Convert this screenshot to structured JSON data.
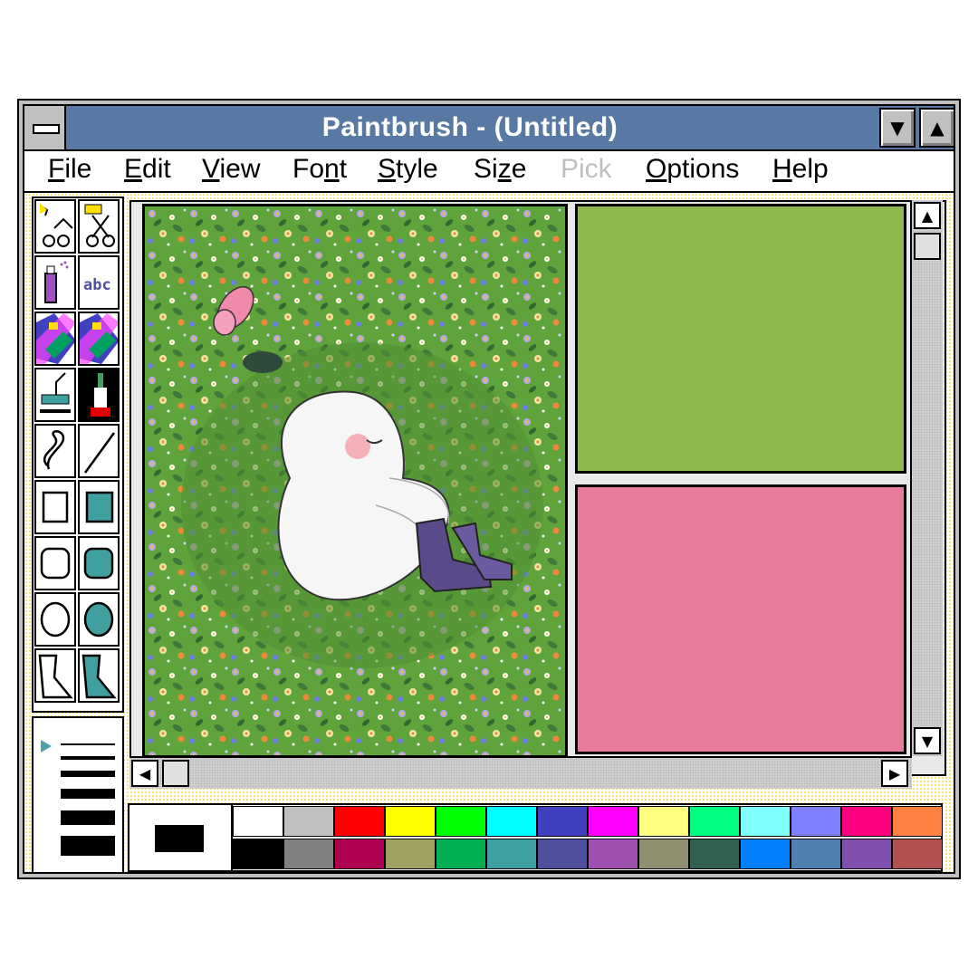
{
  "window": {
    "title": "Paintbrush - (Untitled)"
  },
  "menu": [
    {
      "label": "File",
      "u": "F",
      "rest": "ile",
      "disabled": false
    },
    {
      "label": "Edit",
      "u": "E",
      "rest": "dit",
      "disabled": false
    },
    {
      "label": "View",
      "u": "V",
      "rest": "iew",
      "disabled": false
    },
    {
      "label": "Font",
      "pre": "Fo",
      "u": "n",
      "rest": "t",
      "disabled": false
    },
    {
      "label": "Style",
      "u": "S",
      "rest": "tyle",
      "disabled": false
    },
    {
      "label": "Size",
      "pre": "Si",
      "u": "z",
      "rest": "e",
      "disabled": false
    },
    {
      "label": "Pick",
      "u": "",
      "rest": "Pick",
      "disabled": true
    },
    {
      "label": "Options",
      "u": "O",
      "rest": "ptions",
      "disabled": false
    },
    {
      "label": "Help",
      "u": "H",
      "rest": "elp",
      "disabled": false
    }
  ],
  "tools": [
    "pick-scissors-tool",
    "scissors-tool",
    "airbrush-tool",
    "text-tool",
    "color-eraser-tool",
    "eraser-tool",
    "paint-roller-tool",
    "brush-tool",
    "curve-tool",
    "line-tool",
    "box-tool",
    "filled-box-tool",
    "rounded-box-tool",
    "filled-rounded-box-tool",
    "circle-tool",
    "filled-circle-tool",
    "polygon-tool",
    "filled-polygon-tool"
  ],
  "tool_text": "abc",
  "panels": {
    "left_color": "#5fa33b",
    "top_right_color": "#8fb94e",
    "bottom_right_color": "#e57c9a"
  },
  "palette": {
    "top": [
      "#ffffff",
      "#c0c0c0",
      "#ff0000",
      "#ffff00",
      "#00ff00",
      "#00ffff",
      "#4040c0",
      "#ff00ff",
      "#ffff80",
      "#00ff80",
      "#80ffff",
      "#8080ff",
      "#ff0080",
      "#ff8040"
    ],
    "bottom": [
      "#000000",
      "#808080",
      "#b00050",
      "#a0a060",
      "#00b050",
      "#40a0a0",
      "#5050a0",
      "#a050b0",
      "#909070",
      "#306050",
      "#0080ff",
      "#5080b0",
      "#8050b0",
      "#b05050"
    ]
  }
}
